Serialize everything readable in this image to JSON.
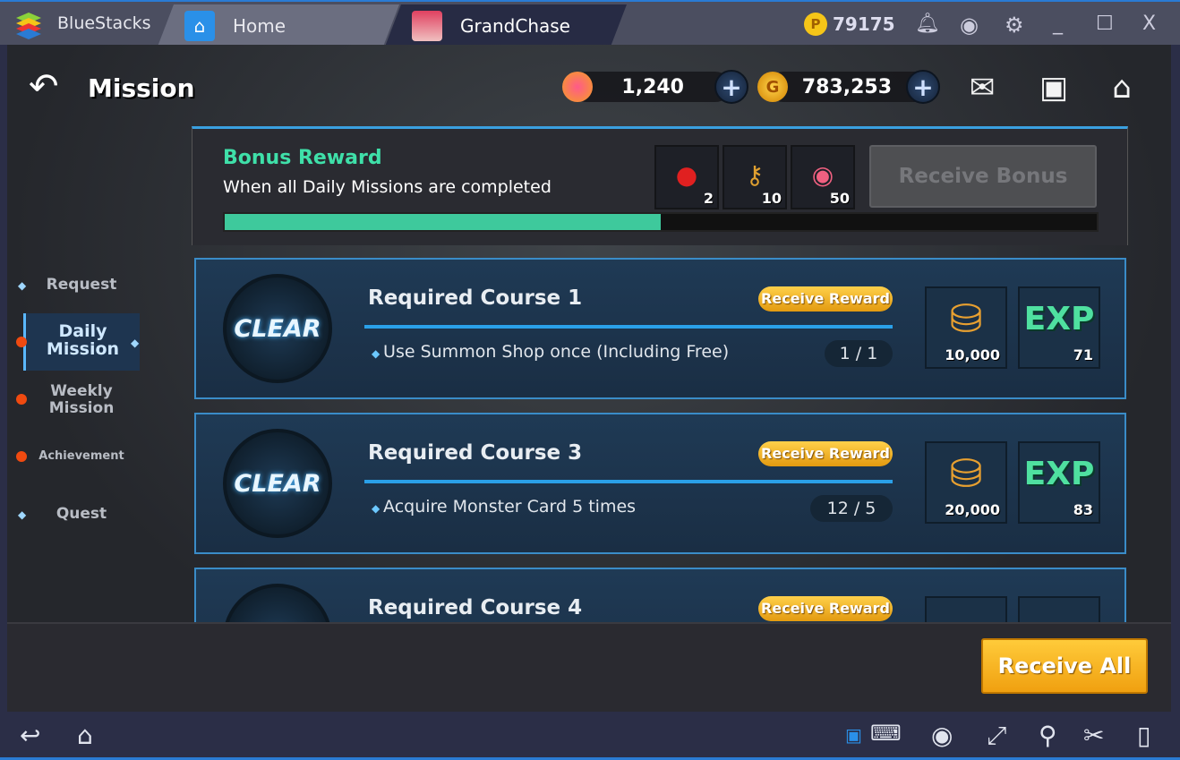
{
  "window": {
    "brand": "BlueStacks",
    "tabs": [
      {
        "label": "Home",
        "icon": "home-icon"
      },
      {
        "label": "GrandChase",
        "icon": "game-avatar"
      }
    ],
    "points": "79175",
    "icons": [
      "coin-icon",
      "bell-icon",
      "account-icon",
      "gear-icon",
      "minimize-icon",
      "maximize-icon",
      "close-icon"
    ]
  },
  "header": {
    "title": "Mission",
    "gems": "1,240",
    "gold": "783,253",
    "icons": [
      "back-arrow-icon",
      "mail-icon",
      "inventory-icon",
      "home-icon"
    ]
  },
  "bonus": {
    "title": "Bonus Reward",
    "subtitle": "When all Daily Missions are completed",
    "items": [
      {
        "icon": "gem-bundle-icon",
        "count": "2"
      },
      {
        "icon": "key-icon",
        "count": "10"
      },
      {
        "icon": "gem-icon",
        "count": "50"
      }
    ],
    "button": "Receive Bonus",
    "progress": 0.5,
    "accent": "#3fe0a9"
  },
  "sidebar": {
    "items": [
      {
        "label": "Request"
      },
      {
        "label": "Daily Mission",
        "active": true
      },
      {
        "label": "Weekly Mission"
      },
      {
        "label": "Achievement"
      },
      {
        "label": "Quest"
      }
    ]
  },
  "missions": [
    {
      "status": "CLEAR",
      "title": "Required Course 1",
      "button": "Receive Reward",
      "task": "Use Summon Shop once (Including Free)",
      "progress": "1 / 1",
      "gold": "10,000",
      "exp_label": "EXP",
      "exp": "71"
    },
    {
      "status": "CLEAR",
      "title": "Required Course 3",
      "button": "Receive Reward",
      "task": "Acquire Monster Card 5 times",
      "progress": "12 / 5",
      "gold": "20,000",
      "exp_label": "EXP",
      "exp": "83"
    },
    {
      "title": "Required Course 4",
      "button": "Receive Reward"
    }
  ],
  "footer": {
    "receive_all": "Receive All"
  },
  "navbar": {
    "icons": [
      "back-icon",
      "home-icon",
      "keyboard-lock-icon",
      "keyboard-icon",
      "eye-icon",
      "fullscreen-icon",
      "location-icon",
      "scissors-icon",
      "rotate-icon"
    ]
  }
}
